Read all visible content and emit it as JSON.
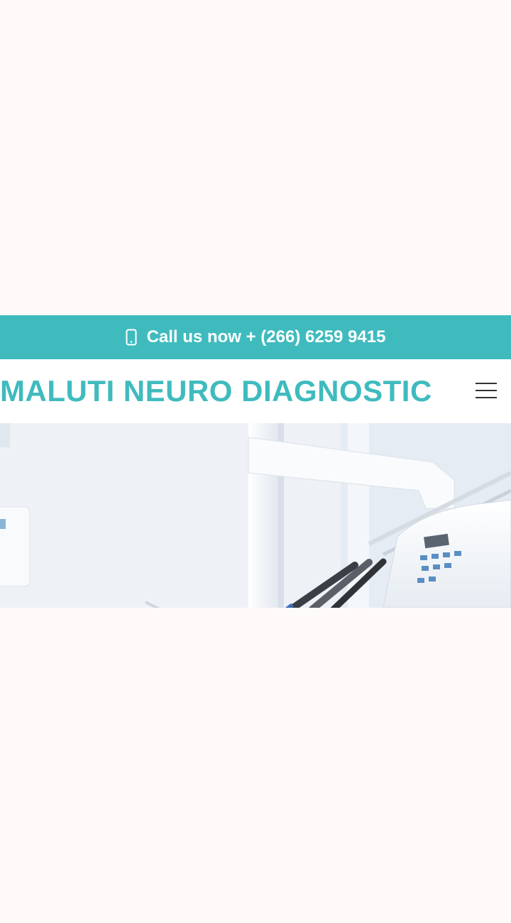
{
  "callbar": {
    "text": "Call us now + (266) 6259 9415",
    "icon": "mobile-phone-icon"
  },
  "header": {
    "brand": "MALUTI NEURO DIAGNOSTIC",
    "menu_icon": "hamburger-menu-icon"
  },
  "hero": {
    "image": "dental-clinic-equipment-photo"
  },
  "colors": {
    "accent": "#3fbbbe",
    "page_background": "#fefafa",
    "menu_icon": "#333333"
  }
}
